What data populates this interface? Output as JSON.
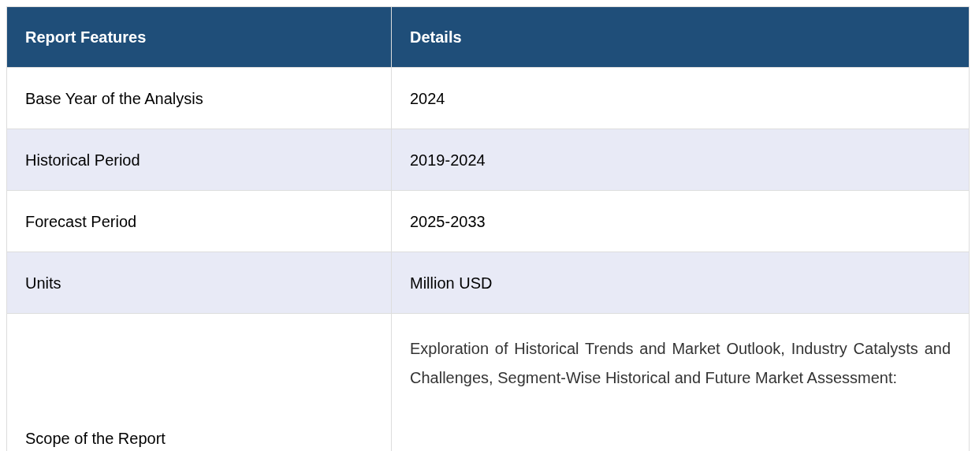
{
  "table": {
    "columns": [
      "Report Features",
      "Details"
    ],
    "rows": [
      {
        "feature": "Base Year of the Analysis",
        "details": "2024"
      },
      {
        "feature": "Historical Period",
        "details": "2019-2024"
      },
      {
        "feature": "Forecast Period",
        "details": "2025-2033"
      },
      {
        "feature": "Units",
        "details": "Million USD"
      },
      {
        "feature": "Scope of the Report",
        "details": "Exploration of Historical Trends and Market Outlook, Industry Catalysts and Challenges, Segment-Wise Historical and Future Market Assessment:"
      }
    ]
  }
}
